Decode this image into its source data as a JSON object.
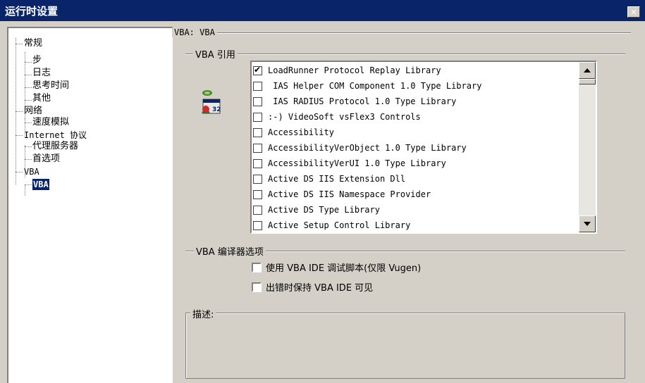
{
  "window": {
    "title": "运行时设置",
    "close_glyph": "✕"
  },
  "tree": {
    "items": [
      {
        "label": "常规"
      },
      {
        "label": "步"
      },
      {
        "label": "日志"
      },
      {
        "label": "思考时间"
      },
      {
        "label": "其他"
      },
      {
        "label": "网络"
      },
      {
        "label": "速度模拟"
      },
      {
        "label": "Internet 协议"
      },
      {
        "label": "代理服务器"
      },
      {
        "label": "首选项"
      },
      {
        "label": "VBA"
      },
      {
        "label": "VBA",
        "selected": true
      }
    ]
  },
  "panel": {
    "title": "VBA: VBA",
    "references_group": "VBA 引用",
    "references_icon": "vba-library-icon",
    "references": [
      {
        "label": "LoadRunner Protocol Replay Library",
        "checked": true
      },
      {
        "label": " IAS Helper COM Component 1.0 Type Library",
        "checked": false
      },
      {
        "label": " IAS RADIUS Protocol 1.0 Type Library",
        "checked": false
      },
      {
        "label": ":-) VideoSoft vsFlex3 Controls",
        "checked": false
      },
      {
        "label": "Accessibility",
        "checked": false
      },
      {
        "label": "AccessibilityVerObject 1.0 Type Library",
        "checked": false
      },
      {
        "label": "AccessibilityVerUI 1.0 Type Library",
        "checked": false
      },
      {
        "label": "Active DS IIS Extension Dll",
        "checked": false
      },
      {
        "label": "Active DS IIS Namespace Provider",
        "checked": false
      },
      {
        "label": "Active DS Type Library",
        "checked": false
      },
      {
        "label": "Active Setup Control Library",
        "checked": false
      }
    ],
    "compiler_group": "VBA 编译器选项",
    "compiler_options": [
      {
        "label": "使用 VBA IDE 调试脚本(仅限 Vugen)",
        "checked": false
      },
      {
        "label": "出错时保持 VBA IDE 可见",
        "checked": false
      }
    ],
    "description_label": "描述:"
  },
  "colors": {
    "titlebar": "#0a246a",
    "face": "#d4d0c8",
    "selected": "#0a246a"
  }
}
